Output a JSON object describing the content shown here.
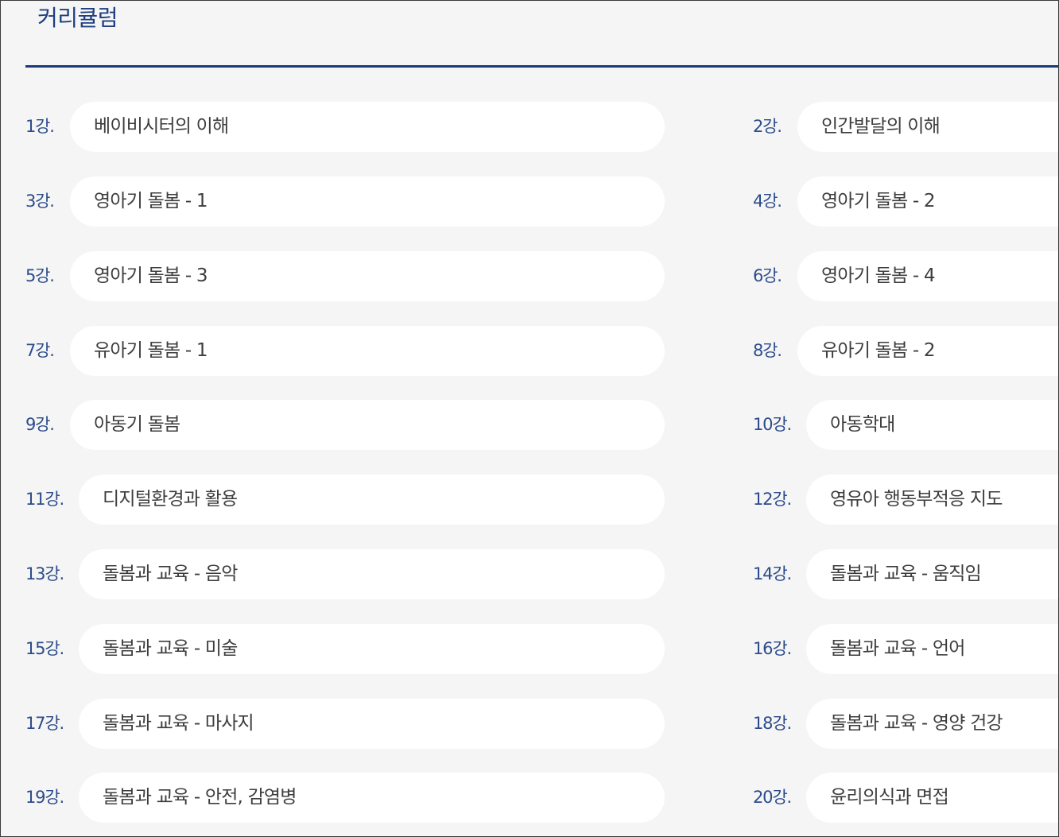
{
  "page": {
    "title": "커리큘럼"
  },
  "curriculum": {
    "lessons": [
      {
        "number": "1강.",
        "title": "베이비시터의 이해"
      },
      {
        "number": "2강.",
        "title": "인간발달의 이해"
      },
      {
        "number": "3강.",
        "title": "영아기 돌봄 - 1"
      },
      {
        "number": "4강.",
        "title": "영아기 돌봄 - 2"
      },
      {
        "number": "5강.",
        "title": "영아기 돌봄 - 3"
      },
      {
        "number": "6강.",
        "title": "영아기 돌봄 - 4"
      },
      {
        "number": "7강.",
        "title": "유아기 돌봄 - 1"
      },
      {
        "number": "8강.",
        "title": "유아기 돌봄 - 2"
      },
      {
        "number": "9강.",
        "title": "아동기 돌봄"
      },
      {
        "number": "10강.",
        "title": "아동학대"
      },
      {
        "number": "11강.",
        "title": "디지털환경과 활용"
      },
      {
        "number": "12강.",
        "title": "영유아 행동부적응 지도"
      },
      {
        "number": "13강.",
        "title": "돌봄과 교육 - 음악"
      },
      {
        "number": "14강.",
        "title": "돌봄과 교육 - 움직임"
      },
      {
        "number": "15강.",
        "title": "돌봄과 교육 - 미술"
      },
      {
        "number": "16강.",
        "title": "돌봄과 교육 - 언어"
      },
      {
        "number": "17강.",
        "title": "돌봄과 교육 - 마사지"
      },
      {
        "number": "18강.",
        "title": "돌봄과 교육 - 영양 건강"
      },
      {
        "number": "19강.",
        "title": "돌봄과 교육 - 안전, 감염병"
      },
      {
        "number": "20강.",
        "title": "윤리의식과 면접"
      }
    ]
  },
  "colors": {
    "accent": "#1f3f80",
    "number_text": "#2c4c8c",
    "pill_background": "#ffffff",
    "page_background": "#f5f5f5",
    "body_text": "#3d3d3d"
  }
}
